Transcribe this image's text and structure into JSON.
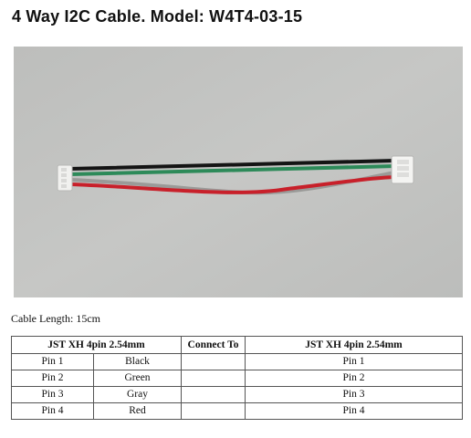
{
  "title": "4 Way I2C Cable. Model: W4T4-03-15",
  "photo": {
    "wire_colors": [
      "#141414",
      "#2d8a59",
      "#9a9a98",
      "#c8202a"
    ],
    "background_color": "#c3c4c2"
  },
  "cable_length": "Cable Length: 15cm",
  "table": {
    "headers": [
      "JST XH 4pin 2.54mm",
      "Connect To",
      "JST XH 4pin 2.54mm"
    ],
    "rows": [
      {
        "pin": "Pin 1",
        "color": "Black",
        "to": "Pin 1"
      },
      {
        "pin": "Pin 2",
        "color": "Green",
        "to": "Pin 2"
      },
      {
        "pin": "Pin 3",
        "color": "Gray",
        "to": "Pin 3"
      },
      {
        "pin": "Pin 4",
        "color": "Red",
        "to": "Pin 4"
      }
    ]
  }
}
